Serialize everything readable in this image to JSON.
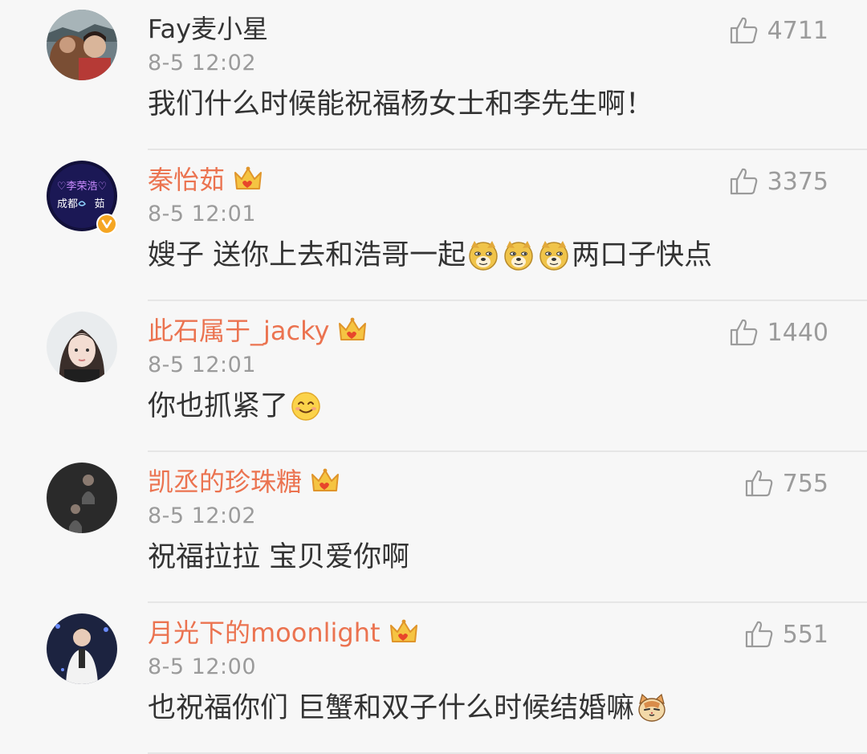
{
  "colors": {
    "vip_name": "#eb7350",
    "plain_name": "#333333",
    "meta_gray": "#9b9b9b",
    "background": "#f7f7f7",
    "crown_gold": "#f5a623"
  },
  "comments": [
    {
      "username": "Fay麦小星",
      "vip": false,
      "verified": false,
      "time": "8-5 12:02",
      "likes": "4711",
      "content": [
        {
          "type": "text",
          "value": "我们什么时候能祝福杨女士和李先生啊！"
        }
      ]
    },
    {
      "username": "秦怡茹",
      "vip": true,
      "verified": true,
      "avatar_text": {
        "line1": "♡李荣浩♡",
        "line2": "成都",
        "line3": "茹"
      },
      "time": "8-5 12:01",
      "likes": "3375",
      "content": [
        {
          "type": "text",
          "value": "嫂子 送你上去和浩哥一起"
        },
        {
          "type": "emoji",
          "icon": "doge-icon"
        },
        {
          "type": "emoji",
          "icon": "doge-icon"
        },
        {
          "type": "emoji",
          "icon": "doge-icon"
        },
        {
          "type": "text",
          "value": "两口子快点"
        }
      ]
    },
    {
      "username": "此石属于_jacky",
      "vip": true,
      "verified": false,
      "time": "8-5 12:01",
      "likes": "1440",
      "content": [
        {
          "type": "text",
          "value": "你也抓紧了"
        },
        {
          "type": "emoji",
          "icon": "smile-icon"
        }
      ]
    },
    {
      "username": "凯丞的珍珠糖",
      "vip": true,
      "verified": false,
      "time": "8-5 12:02",
      "likes": "755",
      "content": [
        {
          "type": "text",
          "value": "祝福拉拉 宝贝爱你啊"
        }
      ]
    },
    {
      "username": "月光下的moonlight",
      "vip": true,
      "verified": false,
      "time": "8-5 12:00",
      "likes": "551",
      "content": [
        {
          "type": "text",
          "value": "也祝福你们 巨蟹和双子什么时候结婚嘛"
        },
        {
          "type": "emoji",
          "icon": "cat-icon"
        }
      ]
    }
  ]
}
